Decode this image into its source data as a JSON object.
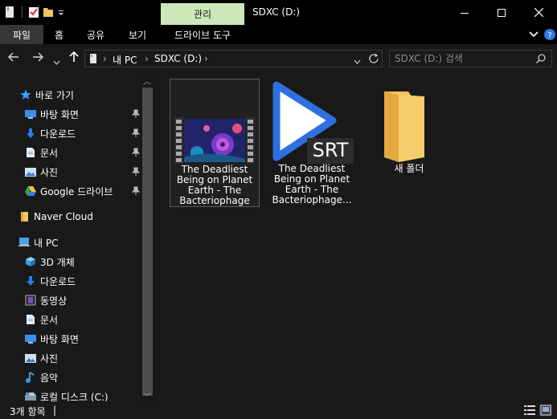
{
  "window": {
    "title": "SDXC (D:)",
    "context_tab": "관리",
    "minimize_icon": "minimize-icon",
    "maximize_icon": "maximize-icon",
    "close_icon": "close-icon"
  },
  "ribbon": {
    "tabs": [
      "파일",
      "홈",
      "공유",
      "보기"
    ],
    "context_label": "드라이브 도구"
  },
  "address": {
    "crumbs": [
      "내 PC",
      "SDXC (D:)"
    ],
    "search_placeholder": "SDXC (D:) 검색"
  },
  "nav": {
    "quick_access": "바로 가기",
    "quick_items": [
      "바탕 화면",
      "다운로드",
      "문서",
      "사진",
      "Google 드라이브"
    ],
    "naver": "Naver Cloud",
    "this_pc": "내 PC",
    "pc_items": [
      "3D 개체",
      "다운로드",
      "동영상",
      "문서",
      "바탕 화면",
      "사진",
      "음악",
      "로컬 디스크 (C:)"
    ]
  },
  "files": [
    {
      "name": "The Deadliest Being on Planet Earth - The Bacteriophage",
      "name_lines": [
        "The Deadliest",
        "Being on Planet",
        "Earth - The",
        "Bacteriophage"
      ],
      "type": "video"
    },
    {
      "name": "The Deadliest Being on Planet Earth - The Bacteriophage...",
      "name_lines": [
        "The Deadliest",
        "Being on Planet",
        "Earth - The",
        "Bacteriophage..."
      ],
      "type": "srt",
      "badge": "SRT"
    },
    {
      "name": "새 폴더",
      "name_lines": [
        "새 폴더"
      ],
      "type": "folder"
    }
  ],
  "status": {
    "count": "3개 항목"
  },
  "colors": {
    "background": "#191919",
    "context_tab": "#cbe8b8",
    "folder": "#f2c55c",
    "quick_star": "#3c9cff",
    "play_blue": "#2f6fe0"
  }
}
